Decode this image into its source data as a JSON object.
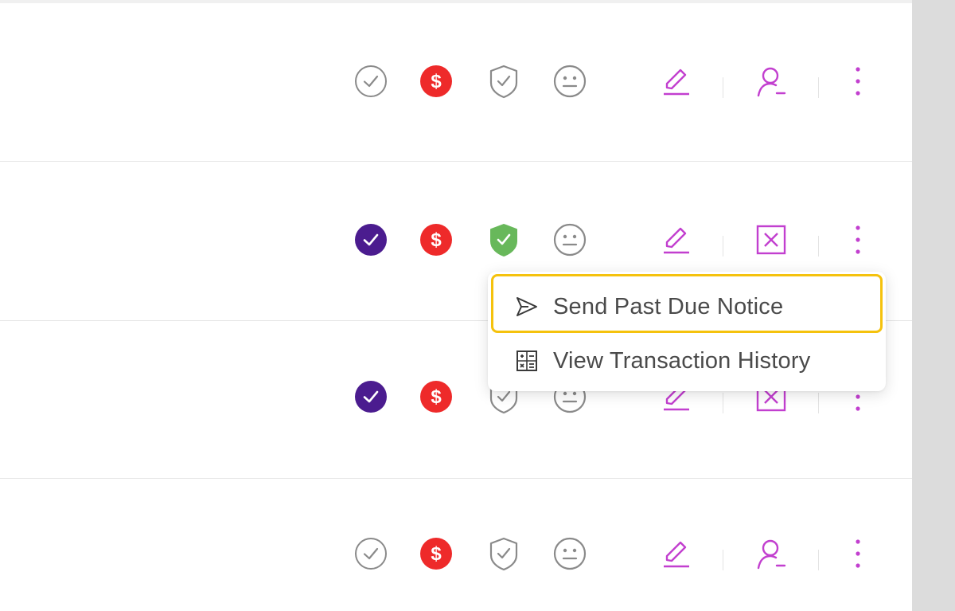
{
  "colors": {
    "accent": "#c23fcf",
    "verified": "#4b1c8f",
    "payment_due": "#ee2a2a",
    "shield_active": "#68b85b",
    "neutral_icon": "#8a8a8a",
    "highlight": "#f5c20d"
  },
  "rows": [
    {
      "icons": [
        "check-circle-outline-icon",
        "dollar-circle-red-icon",
        "shield-check-outline-icon",
        "neutral-face-icon",
        "edit-pencil-icon",
        "user-remove-icon",
        "kebab-menu-icon"
      ]
    },
    {
      "icons": [
        "check-circle-filled-purple-icon",
        "dollar-circle-red-icon",
        "shield-check-filled-green-icon",
        "neutral-face-icon",
        "edit-pencil-icon",
        "close-square-icon",
        "kebab-menu-icon"
      ]
    },
    {
      "icons": [
        "check-circle-filled-purple-icon",
        "dollar-circle-red-icon",
        "shield-check-outline-icon",
        "neutral-face-icon",
        "edit-pencil-icon",
        "close-square-icon",
        "kebab-menu-icon"
      ]
    },
    {
      "icons": [
        "check-circle-outline-icon",
        "dollar-circle-red-icon",
        "shield-check-outline-icon",
        "neutral-face-icon",
        "edit-pencil-icon",
        "user-remove-icon",
        "kebab-menu-icon"
      ]
    }
  ],
  "menu": {
    "items": [
      {
        "label": "Send Past Due Notice",
        "icon": "send-icon",
        "highlighted": true
      },
      {
        "label": "View Transaction History",
        "icon": "transaction-history-icon",
        "highlighted": false
      }
    ]
  }
}
